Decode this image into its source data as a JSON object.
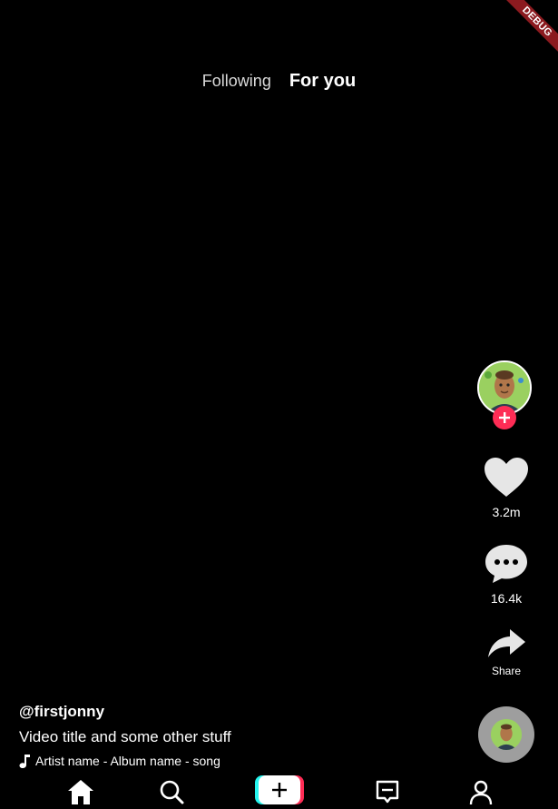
{
  "debug_banner": "DEBUG",
  "tabs": [
    {
      "label": "Following",
      "active": false
    },
    {
      "label": "For you",
      "active": true
    }
  ],
  "actions": {
    "likes": "3.2m",
    "comments": "16.4k",
    "share_label": "Share"
  },
  "video": {
    "username": "@firstjonny",
    "title": "Video title and some other stuff",
    "music": "Artist name - Album name - song"
  },
  "icons": {
    "home": "home-icon",
    "search": "search-icon",
    "create": "plus-icon",
    "inbox": "inbox-icon",
    "profile": "profile-icon",
    "like": "heart-icon",
    "comment": "comment-icon",
    "share": "share-icon",
    "music": "music-note-icon"
  },
  "colors": {
    "background": "#000000",
    "accent_red": "#fe2c55",
    "accent_cyan": "#25f4ee",
    "icon_white": "#e6e6e6",
    "debug_red": "#8b1a1f"
  }
}
